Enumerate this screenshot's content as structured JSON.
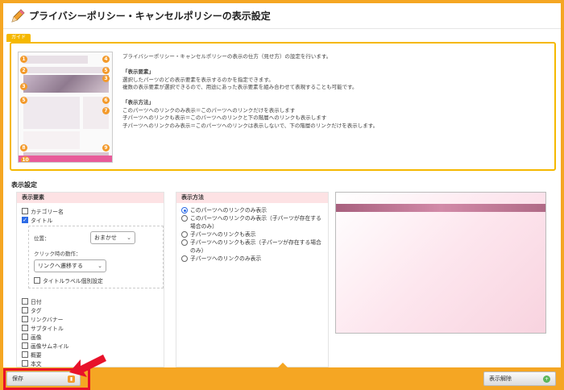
{
  "header": {
    "title": "プライバシーポリシー・キャンセルポリシーの表示設定",
    "icon": "pencil-icon"
  },
  "guide": {
    "tag": "ガイド",
    "badges": [
      "1",
      "2",
      "3",
      "4",
      "5",
      "6",
      "7",
      "8",
      "9",
      "10",
      "3",
      "5"
    ],
    "lines": [
      "プライバシーポリシー・キャンセルポリシーの表示の仕方（見せ方）の設定を行います。",
      "",
      "「表示要素」",
      "選択したパーツのどの表示要素を表示するのかを指定できます。",
      "複数の表示要素が選択できるので、用途にあった表示要素を組み合わせて表現することも可能です。",
      "",
      "「表示方法」",
      "このパーツへのリンクのみ表示＝このパーツへのリンクだけを表示します",
      "子パーツへのリンクも表示＝このパーツへのリンクと下の階層へのリンクも表示します",
      "子パーツへのリンクのみ表示＝このパーツへのリンクは表示しないで、下の階層のリンクだけを表示します。"
    ]
  },
  "settings": {
    "title": "表示設定",
    "elements": {
      "head": "表示要素",
      "items": [
        {
          "label": "カテゴリー名",
          "checked": false
        },
        {
          "label": "タイトル",
          "checked": true
        }
      ],
      "position_label": "位置：",
      "position_value": "おまかせ",
      "click_label": "クリック時の動作：",
      "click_value": "リンクへ遷移する",
      "title_label_setting": "タイトルラベル個別設定",
      "more_items": [
        "日付",
        "タグ",
        "リンクバナー",
        "サブタイトル",
        "画像",
        "画像サムネイル",
        "概要",
        "本文"
      ]
    },
    "methods": {
      "head": "表示方法",
      "options": [
        {
          "label": "このパーツへのリンクのみ表示",
          "checked": true
        },
        {
          "label": "このパーツへのリンクのみ表示（子パーツが存在する場合のみ）",
          "checked": false
        },
        {
          "label": "子パーツへのリンクも表示",
          "checked": false
        },
        {
          "label": "子パーツへのリンクも表示（子パーツが存在する場合のみ）",
          "checked": false
        },
        {
          "label": "子パーツへのリンクのみ表示",
          "checked": false
        }
      ]
    }
  },
  "footer": {
    "save_label": "保存",
    "release_label": "表示解除"
  },
  "colors": {
    "accent": "#f5a623",
    "guide_border": "#f5b800",
    "panel_head": "#fde2e4",
    "highlight": "#e8122a"
  }
}
